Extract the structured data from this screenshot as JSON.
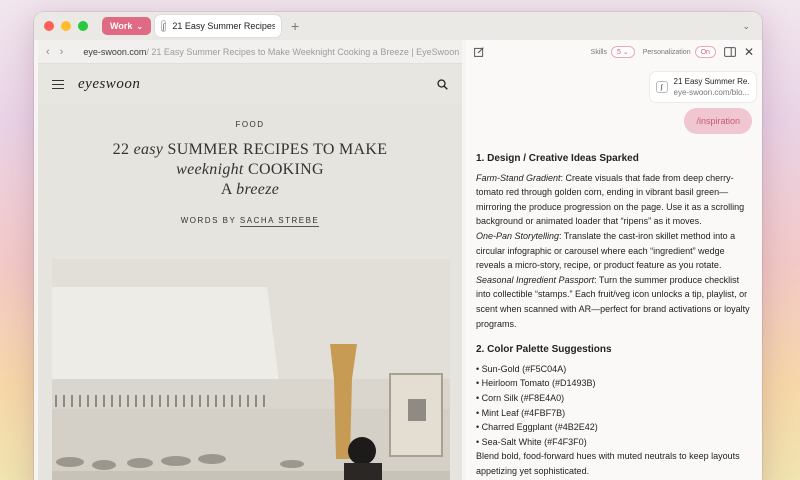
{
  "titlebar": {
    "profile_label": "Work",
    "tab_title": "21 Easy Summer Recipes to Make Weeknight Cooking a Breeze | EyeSwoon"
  },
  "browser": {
    "url_host": "eye-swoon.com",
    "url_rest": "/ 21 Easy Summer Recipes to Make Weeknight Cooking a Breeze | EyeSwoon"
  },
  "site": {
    "logo": "eyeswoon",
    "category": "FOOD",
    "headline": {
      "line1_num": "22",
      "line1_italic": "easy",
      "line1_rest": "SUMMER RECIPES TO MAKE",
      "line2_italic": "weeknight",
      "line2_rest": "COOKING",
      "line3_a": "A",
      "line3_italic": "breeze"
    },
    "byline_prefix": "WORDS BY",
    "author": "SACHA STREBE"
  },
  "assistant": {
    "skills_label": "Skills",
    "skills_count": "5",
    "personalization_label": "Personalization",
    "personalization_value": "On",
    "context_card": {
      "title": "21 Easy Summer Re...",
      "url": "eye-swoon.com/blo..."
    },
    "user_message": "/inspiration",
    "section1": {
      "heading": "1. Design / Creative Ideas Sparked",
      "items": [
        {
          "term": "Farm-Stand Gradient",
          "text": ": Create visuals that fade from deep cherry-tomato red through golden corn, ending in vibrant basil green—mirroring the produce progression on the page. Use it as a scrolling background or animated loader that “ripens” as it moves."
        },
        {
          "term": "One-Pan Storytelling",
          "text": ": Translate the cast-iron skillet method into a circular infographic or carousel where each “ingredient” wedge reveals a micro-story, recipe, or product feature as you rotate."
        },
        {
          "term": "Seasonal Ingredient Passport",
          "text": ": Turn the summer produce checklist into collectible “stamps.” Each fruit/veg icon unlocks a tip, playlist, or scent when scanned with AR—perfect for brand activations or loyalty programs."
        }
      ]
    },
    "section2": {
      "heading": "2. Color Palette Suggestions",
      "colors": [
        "• Sun-Gold (#F5C04A)",
        "• Heirloom Tomato (#D1493B)",
        "• Corn Silk (#F8E4A0)",
        "• Mint Leaf (#4FBF7B)",
        "• Charred Eggplant (#4B2E42)",
        "• Sea-Salt White (#F4F3F0)"
      ],
      "closing": "Blend bold, food-forward hues with muted neutrals to keep layouts appetizing yet sophisticated."
    }
  }
}
